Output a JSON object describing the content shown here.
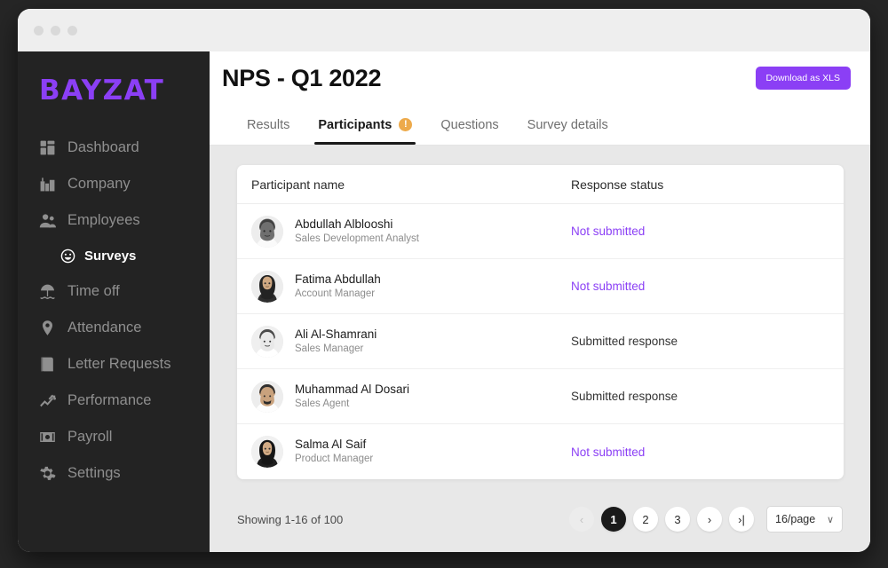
{
  "window": {
    "traffic_lights": [
      "close",
      "minimize",
      "maximize"
    ]
  },
  "sidebar": {
    "logo": "BAYZAT",
    "items": [
      {
        "label": "Dashboard",
        "icon": "dashboard-icon",
        "active": false
      },
      {
        "label": "Company",
        "icon": "company-icon",
        "active": false
      },
      {
        "label": "Employees",
        "icon": "employees-icon",
        "active": false
      },
      {
        "label": "Time off",
        "icon": "time-off-icon",
        "active": false
      },
      {
        "label": "Attendance",
        "icon": "attendance-pin-icon",
        "active": false
      },
      {
        "label": "Letter Requests",
        "icon": "letter-requests-icon",
        "active": false
      },
      {
        "label": "Performance",
        "icon": "performance-icon",
        "active": false
      },
      {
        "label": "Payroll",
        "icon": "payroll-icon",
        "active": false
      },
      {
        "label": "Settings",
        "icon": "gear-icon",
        "active": false
      }
    ],
    "sub_item": {
      "label": "Surveys",
      "icon": "smiley-icon",
      "active": true
    }
  },
  "header": {
    "title": "NPS - Q1 2022",
    "download_label": "Download as XLS"
  },
  "tabs": [
    {
      "label": "Results",
      "active": false,
      "badge": null
    },
    {
      "label": "Participants",
      "active": true,
      "badge": "!"
    },
    {
      "label": "Questions",
      "active": false,
      "badge": null
    },
    {
      "label": "Survey details",
      "active": false,
      "badge": null
    }
  ],
  "table": {
    "columns": {
      "name": "Participant name",
      "status": "Response status"
    },
    "rows": [
      {
        "name": "Abdullah Alblooshi",
        "title": "Sales Development Analyst",
        "status": "Not submitted",
        "status_type": "not-submitted",
        "avatar": "avatar-man-keffiyeh"
      },
      {
        "name": "Fatima Abdullah",
        "title": "Account Manager",
        "status": "Not submitted",
        "status_type": "not-submitted",
        "avatar": "avatar-woman-hijab"
      },
      {
        "name": "Ali Al-Shamrani",
        "title": "Sales Manager",
        "status": "Submitted response",
        "status_type": "submitted",
        "avatar": "avatar-man-keffiyeh"
      },
      {
        "name": "Muhammad Al Dosari",
        "title": "Sales Agent",
        "status": "Submitted response",
        "status_type": "submitted",
        "avatar": "avatar-man-keffiyeh"
      },
      {
        "name": "Salma Al Saif",
        "title": "Product Manager",
        "status": "Not submitted",
        "status_type": "not-submitted",
        "avatar": "avatar-woman-hijab"
      }
    ]
  },
  "footer": {
    "showing": "Showing 1-16 of 100",
    "pages": [
      "1",
      "2",
      "3"
    ],
    "active_page": "1",
    "prev_label": "‹",
    "next_label": "›",
    "last_label": "›|",
    "per_page": "16/page",
    "per_page_chevron": "∨"
  },
  "colors": {
    "accent_purple": "#8b3ff5",
    "sidebar_bg": "#232323",
    "page_bg": "#e8e8e8",
    "badge_orange": "#edaa4b",
    "active_page_bg": "#1a1a1a"
  }
}
